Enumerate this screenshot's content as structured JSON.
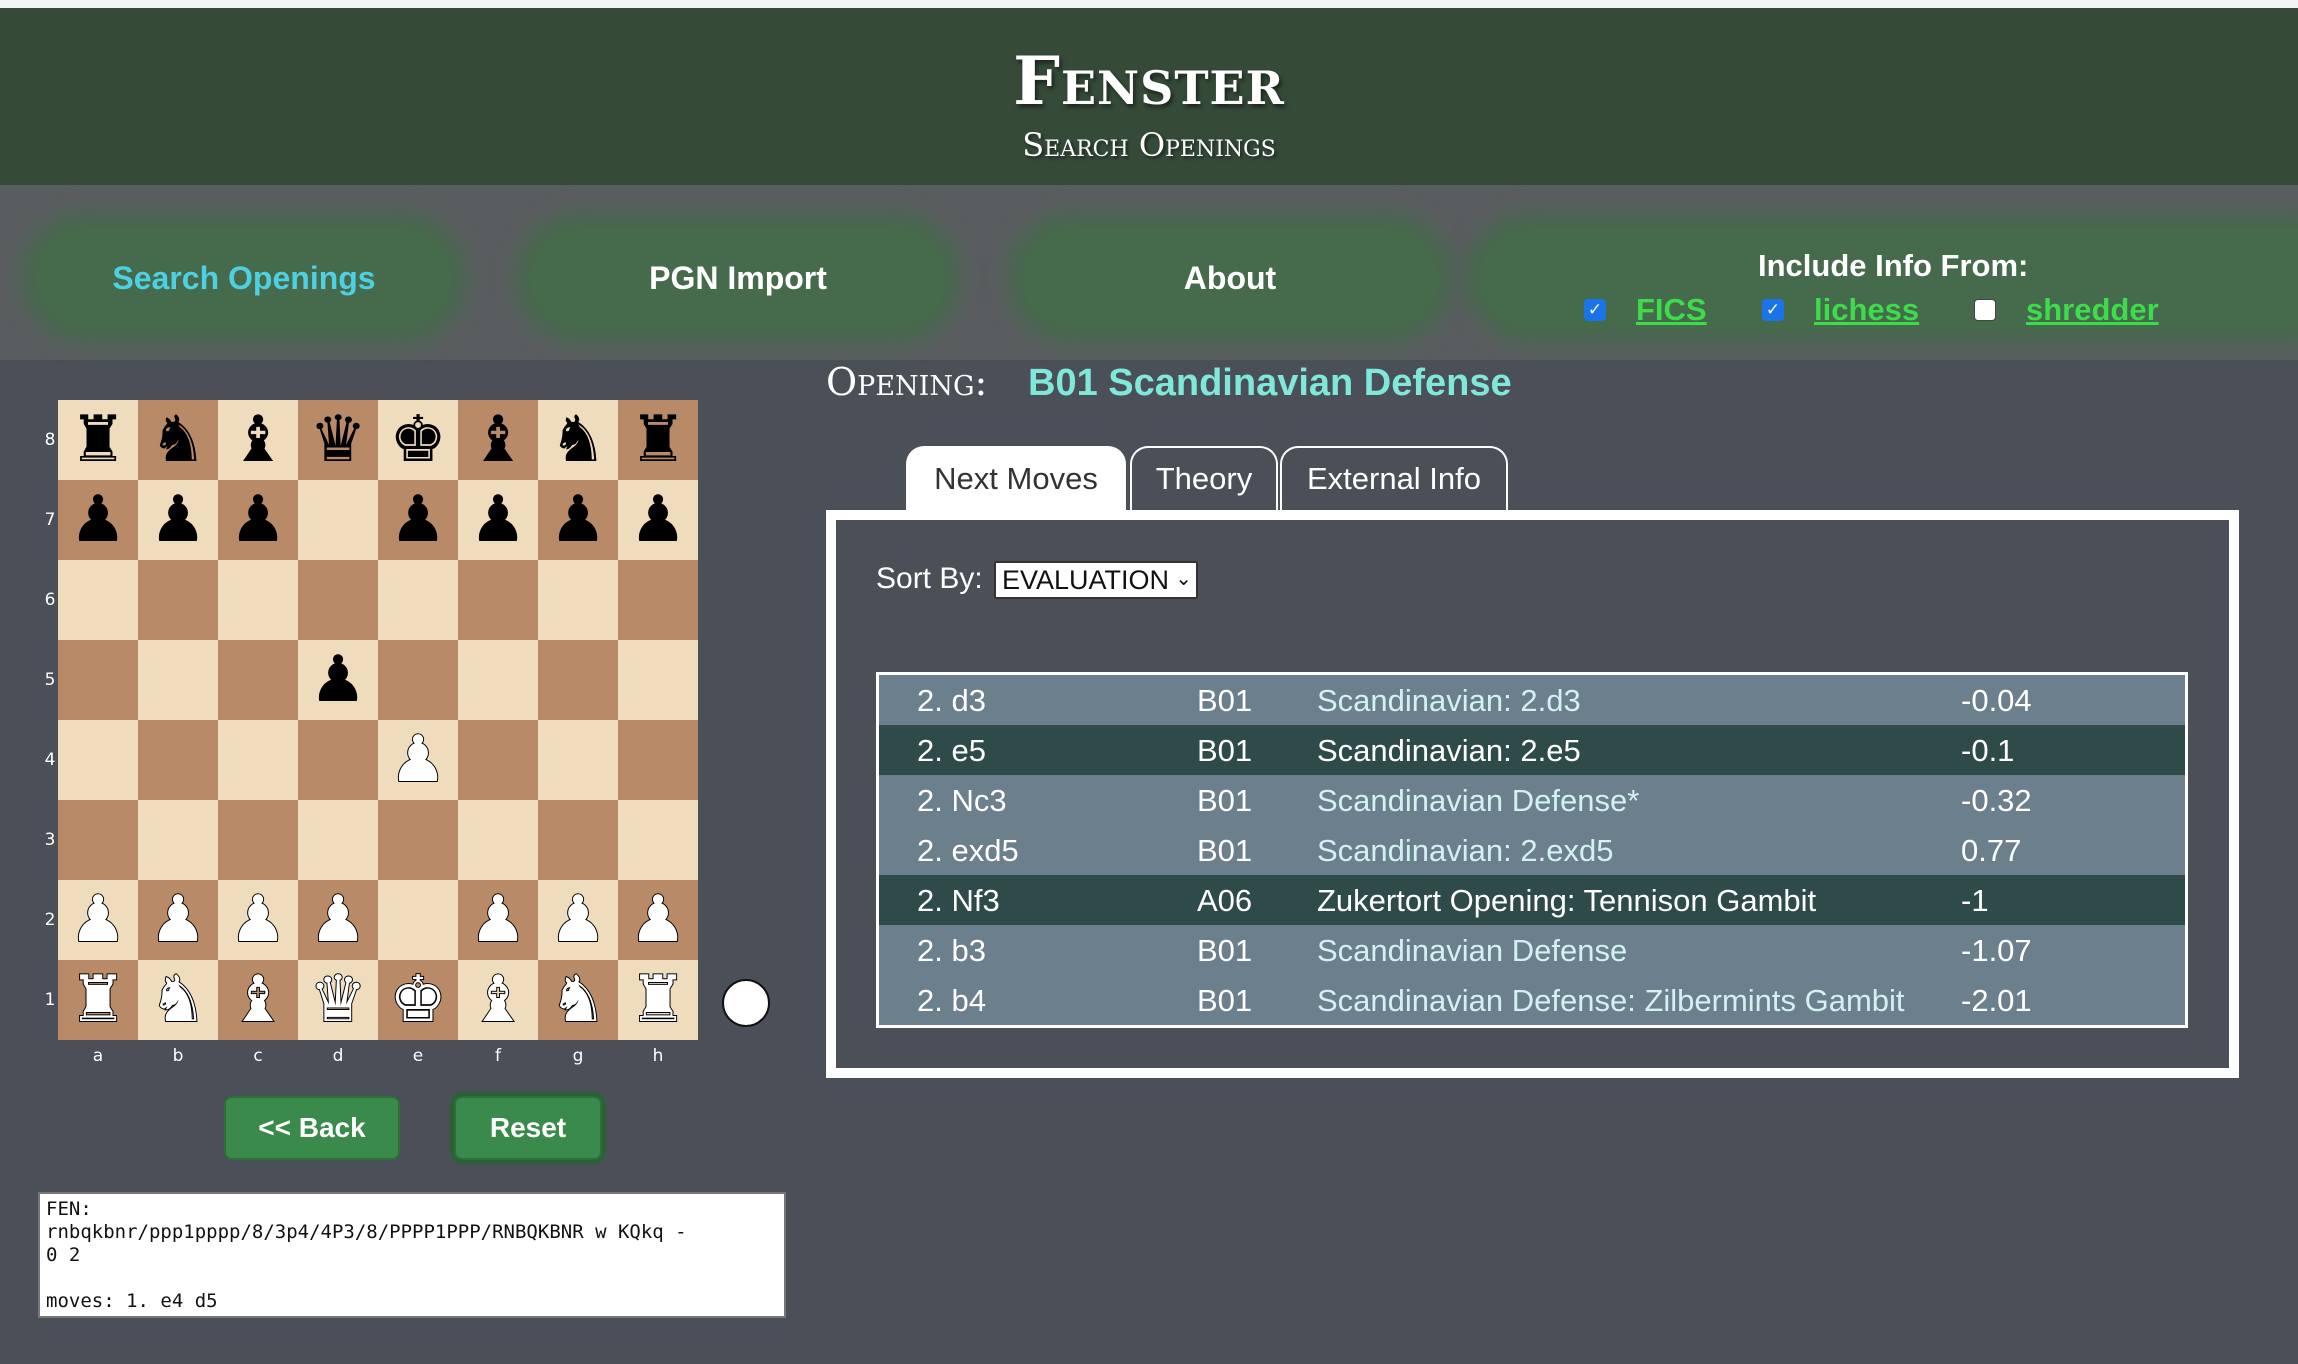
{
  "header": {
    "title": "Fenster",
    "subtitle": "Search Openings"
  },
  "nav": {
    "search_openings": "Search Openings",
    "pgn_import": "PGN Import",
    "about": "About",
    "include_label": "Include Info From:",
    "sources": [
      {
        "label": "FICS",
        "checked": true
      },
      {
        "label": "lichess",
        "checked": true
      },
      {
        "label": "shredder",
        "checked": false
      }
    ]
  },
  "board": {
    "ranks": [
      "8",
      "7",
      "6",
      "5",
      "4",
      "3",
      "2",
      "1"
    ],
    "files": [
      "a",
      "b",
      "c",
      "d",
      "e",
      "f",
      "g",
      "h"
    ],
    "rows": [
      [
        "br",
        "bn",
        "bb",
        "bq",
        "bk",
        "bb",
        "bn",
        "br"
      ],
      [
        "bp",
        "bp",
        "bp",
        "",
        "bp",
        "bp",
        "bp",
        "bp"
      ],
      [
        "",
        "",
        "",
        "",
        "",
        "",
        "",
        ""
      ],
      [
        "",
        "",
        "",
        "bp",
        "",
        "",
        "",
        ""
      ],
      [
        "",
        "",
        "",
        "",
        "wp",
        "",
        "",
        ""
      ],
      [
        "",
        "",
        "",
        "",
        "",
        "",
        "",
        ""
      ],
      [
        "wp",
        "wp",
        "wp",
        "wp",
        "",
        "wp",
        "wp",
        "wp"
      ],
      [
        "wr",
        "wn",
        "wb",
        "wq",
        "wk",
        "wb",
        "wn",
        "wr"
      ]
    ],
    "to_move": "white"
  },
  "controls": {
    "back": "<< Back",
    "reset": "Reset"
  },
  "fen_box": "FEN:\nrnbqkbnr/ppp1pppp/8/3p4/4P3/8/PPPP1PPP/RNBQKBNR w KQkq -\n0 2\n\nmoves: 1. e4 d5",
  "opening": {
    "label": "Opening:",
    "value": "B01 Scandinavian Defense"
  },
  "tabs": [
    "Next Moves",
    "Theory",
    "External Info"
  ],
  "sort": {
    "label": "Sort By:",
    "value": "EVALUATION"
  },
  "moves": [
    {
      "move": "2. d3",
      "eco": "B01",
      "name": "Scandinavian: 2.d3",
      "eval": "-0.04",
      "highlight": false
    },
    {
      "move": "2. e5",
      "eco": "B01",
      "name": "Scandinavian: 2.e5",
      "eval": "-0.1",
      "highlight": true
    },
    {
      "move": "2. Nc3",
      "eco": "B01",
      "name": "Scandinavian Defense*",
      "eval": "-0.32",
      "highlight": false
    },
    {
      "move": "2. exd5",
      "eco": "B01",
      "name": "Scandinavian: 2.exd5",
      "eval": "0.77",
      "highlight": false
    },
    {
      "move": "2. Nf3",
      "eco": "A06",
      "name": "Zukertort Opening: Tennison Gambit",
      "eval": "-1",
      "highlight": true
    },
    {
      "move": "2. b3",
      "eco": "B01",
      "name": "Scandinavian Defense",
      "eval": "-1.07",
      "highlight": false
    },
    {
      "move": "2. b4",
      "eco": "B01",
      "name": "Scandinavian Defense: Zilbermints Gambit",
      "eval": "-2.01",
      "highlight": false
    }
  ],
  "colors": {
    "header_bg": "#354b38",
    "nav_btn": "#466a4c",
    "active_link": "#4dd0e1",
    "source_link": "#3ddc4a",
    "opening_value": "#7fe8d8"
  }
}
